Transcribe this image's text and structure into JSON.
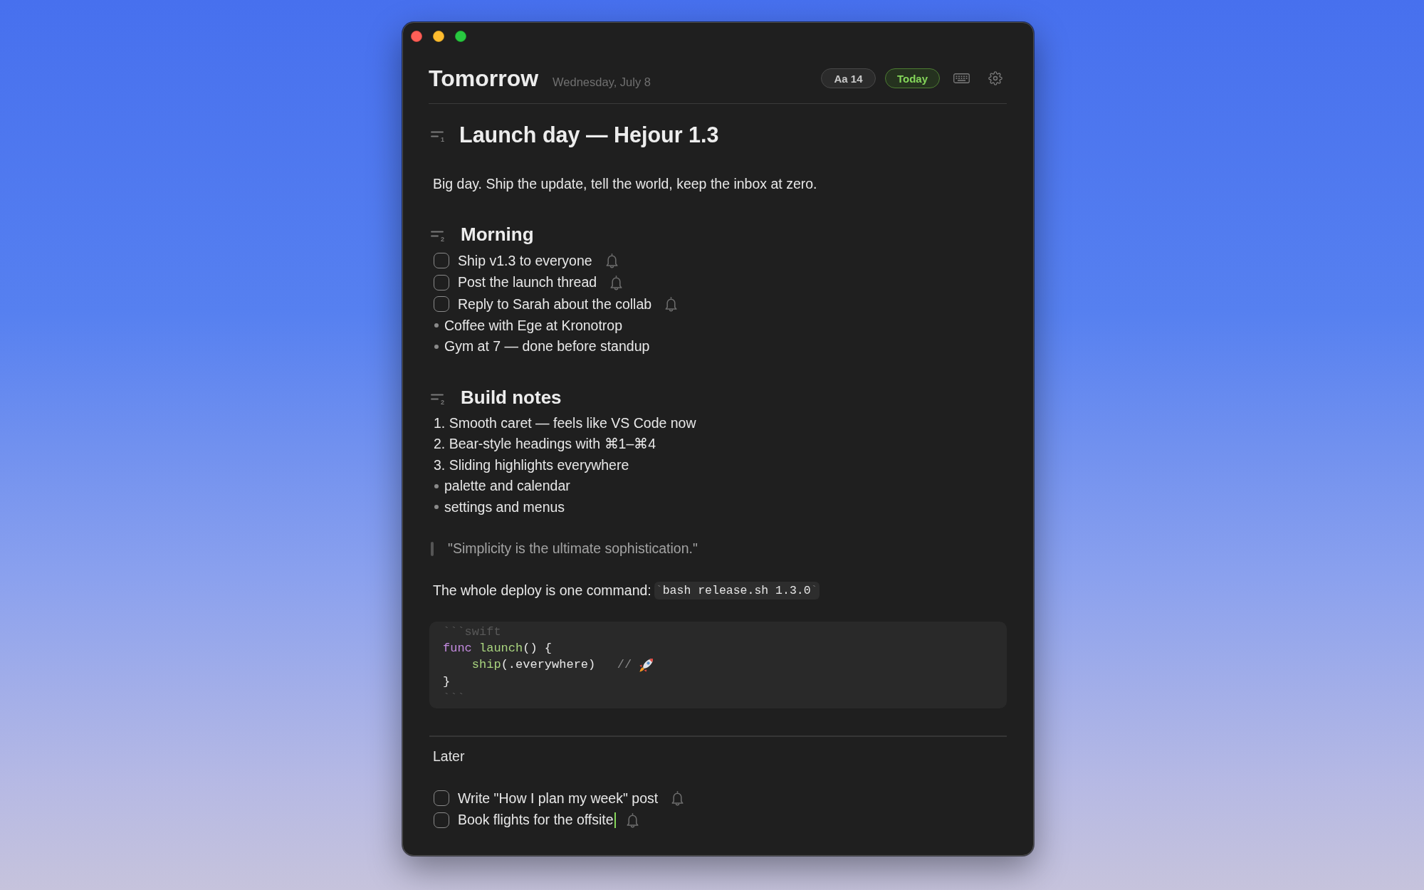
{
  "header": {
    "title": "Tomorrow",
    "date": "Wednesday, July 8",
    "font_size": "Aa 14",
    "today": "Today"
  },
  "document": {
    "blocks": [
      {
        "kind": "h1",
        "marker": "1",
        "text": "Launch day — Hejour 1.3"
      },
      {
        "kind": "paragraph",
        "text": "Big day. Ship the update, tell the world, keep the inbox at zero."
      },
      {
        "kind": "h2",
        "marker": "2",
        "text": "Morning"
      },
      {
        "kind": "task",
        "text": "Ship v1.3 to everyone",
        "checked": false,
        "caret": false
      },
      {
        "kind": "task",
        "text": "Post the launch thread",
        "checked": false,
        "caret": false
      },
      {
        "kind": "task",
        "text": "Reply to Sarah about the collab",
        "checked": false,
        "caret": false
      },
      {
        "kind": "bullet",
        "text": "Coffee with Ege at Kronotrop"
      },
      {
        "kind": "bullet",
        "text": "Gym at 7 — done before standup"
      },
      {
        "kind": "h2",
        "marker": "2",
        "text": "Build notes"
      },
      {
        "kind": "numbered",
        "text": "1. Smooth caret — feels like VS Code now"
      },
      {
        "kind": "numbered",
        "text": "2. Bear-style headings with ⌘1–⌘4"
      },
      {
        "kind": "numbered",
        "text": "3. Sliding highlights everywhere"
      },
      {
        "kind": "bullet",
        "text": "palette and calendar"
      },
      {
        "kind": "bullet",
        "text": "settings and menus"
      },
      {
        "kind": "quote",
        "text": "\"Simplicity is the ultimate sophistication.\""
      },
      {
        "kind": "command",
        "text": "The whole deploy is one command:",
        "code": {
          "open": "`",
          "text": "bash release.sh 1.3.0",
          "close": "`"
        }
      },
      {
        "kind": "code",
        "fence_open": "```swift",
        "lines": [
          [
            {
              "kind": "keyword",
              "text": "func"
            },
            {
              "kind": "function",
              "text": " launch"
            },
            {
              "kind": "plain",
              "text": "() {"
            }
          ],
          [
            {
              "kind": "function",
              "text": "    ship"
            },
            {
              "kind": "plain",
              "text": "(.everywhere)"
            },
            {
              "kind": "comment",
              "text": "   // "
            },
            {
              "kind": "rocket"
            }
          ],
          [
            {
              "kind": "plain",
              "text": "}"
            }
          ]
        ],
        "fence_close": "```"
      }
    ]
  },
  "later": {
    "title": "Later",
    "tasks": [
      {
        "text": "Write \"How I plan my week\" post",
        "checked": false,
        "caret": false
      },
      {
        "text": "Book flights for the offsite",
        "checked": false,
        "caret": true
      }
    ]
  }
}
